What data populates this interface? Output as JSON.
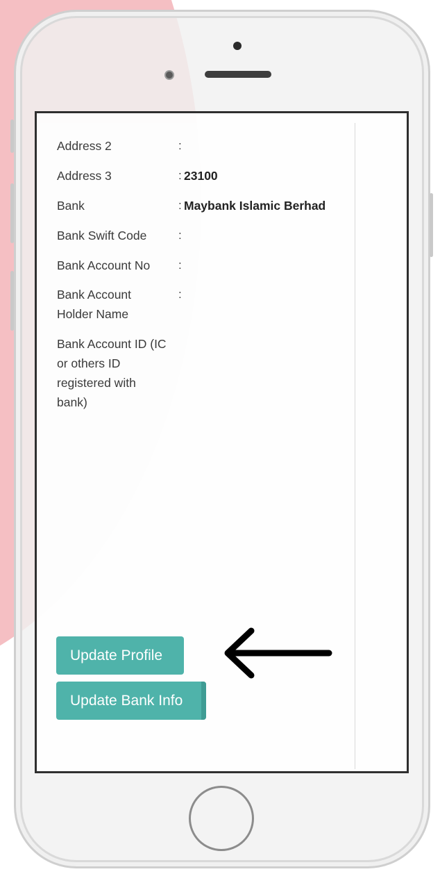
{
  "profile": {
    "rows": [
      {
        "label": "Address 2",
        "colon": ":",
        "value": ""
      },
      {
        "label": "Address 3",
        "colon": ":",
        "value": "23100"
      },
      {
        "label": "Bank",
        "colon": ":",
        "value": "Maybank Islamic Berhad"
      },
      {
        "label": "Bank Swift Code",
        "colon": ":",
        "value": ""
      },
      {
        "label": "Bank Account No",
        "colon": ":",
        "value": ""
      },
      {
        "label": "Bank Account Holder Name",
        "colon": ":",
        "value": ""
      },
      {
        "label": "Bank Account ID (IC or others ID registered with bank)",
        "colon": "",
        "value": ""
      }
    ]
  },
  "actions": {
    "update_profile_label": "Update Profile",
    "update_bank_label": "Update Bank Info"
  },
  "colors": {
    "button": "#4fb3aa",
    "background_circle": "#f4b8bd",
    "arrow": "#000000"
  },
  "icons": {
    "pointer_arrow": "arrow-left-icon"
  }
}
